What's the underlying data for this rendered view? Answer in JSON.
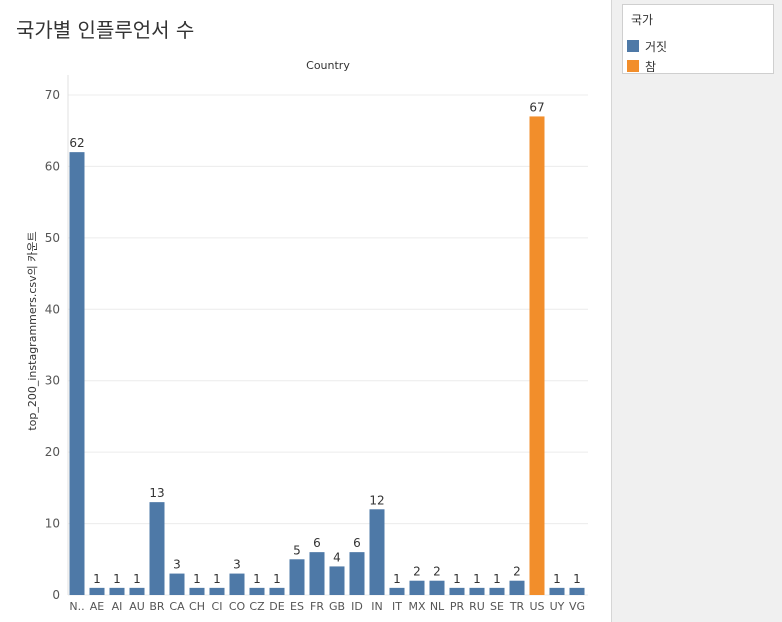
{
  "sheet": {
    "title": "국가별 인플루언서 수"
  },
  "legend": {
    "title": "국가",
    "items": [
      {
        "label": "거짓",
        "color": "#4e79a7"
      },
      {
        "label": "참",
        "color": "#f28e2b"
      }
    ]
  },
  "chart_data": {
    "type": "bar",
    "title": "Country",
    "ylabel": "top_200_instagrammers.csv의 카운트",
    "xlabel": "",
    "ylim": [
      0,
      70
    ],
    "yticks": [
      0,
      10,
      20,
      30,
      40,
      50,
      60,
      70
    ],
    "grid": true,
    "legend_placement": "right",
    "categories": [
      "N..",
      "AE",
      "AI",
      "AU",
      "BR",
      "CA",
      "CH",
      "CI",
      "CO",
      "CZ",
      "DE",
      "ES",
      "FR",
      "GB",
      "ID",
      "IN",
      "IT",
      "MX",
      "NL",
      "PR",
      "RU",
      "SE",
      "TR",
      "US",
      "UY",
      "VG"
    ],
    "values": [
      62,
      1,
      1,
      1,
      13,
      3,
      1,
      1,
      3,
      1,
      1,
      5,
      6,
      4,
      6,
      12,
      1,
      2,
      2,
      1,
      1,
      1,
      2,
      67,
      1,
      1
    ],
    "highlight": [
      false,
      false,
      false,
      false,
      false,
      false,
      false,
      false,
      false,
      false,
      false,
      false,
      false,
      false,
      false,
      false,
      false,
      false,
      false,
      false,
      false,
      false,
      false,
      true,
      false,
      false
    ],
    "colors": {
      "false": "#4e79a7",
      "true": "#f28e2b"
    }
  }
}
